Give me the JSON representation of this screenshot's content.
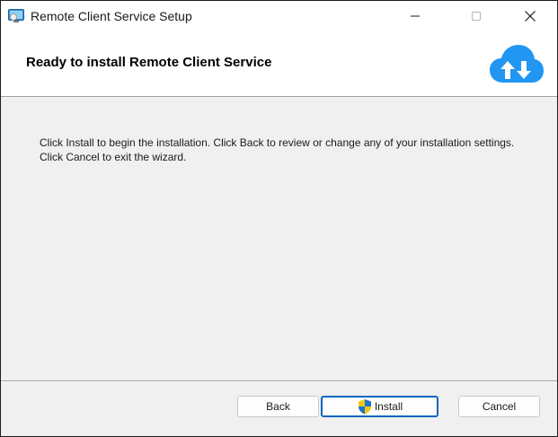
{
  "window": {
    "title": "Remote Client Service Setup",
    "app_icon": "installer-computer-icon",
    "caption_buttons": [
      "minimize-icon",
      "maximize-icon",
      "close-icon"
    ]
  },
  "header": {
    "title": "Ready to install Remote Client Service",
    "logo_icon": "cloud-sync-arrows-icon",
    "logo_color": "#2196f3"
  },
  "body": {
    "message": "Click Install to begin the installation. Click Back to review or change any of your installation settings. Click Cancel to exit the wizard."
  },
  "footer": {
    "back_label": "Back",
    "install_label": "Install",
    "install_icon": "uac-shield-icon",
    "cancel_label": "Cancel",
    "default_button_accent": "#0067c0"
  }
}
